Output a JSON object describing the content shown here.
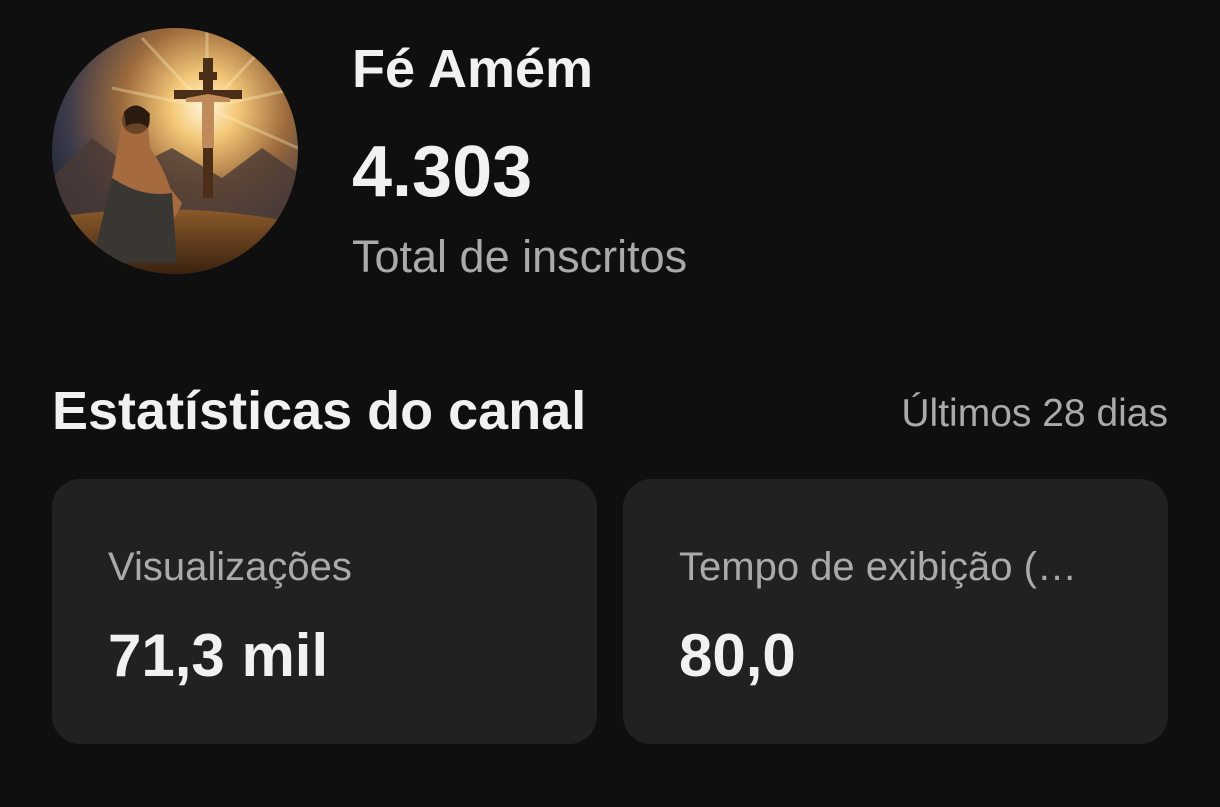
{
  "channel": {
    "name": "Fé Amém",
    "subscriber_count": "4.303",
    "subscriber_label": "Total de inscritos",
    "avatar_icon": "channel-avatar-icon"
  },
  "stats": {
    "title": "Estatísticas do canal",
    "period": "Últimos 28 dias",
    "cards": [
      {
        "label": "Visualizações",
        "value": "71,3 mil"
      },
      {
        "label": "Tempo de exibição (…",
        "value": "80,0"
      }
    ]
  },
  "colors": {
    "background": "#0f0f0f",
    "card": "#212121",
    "primary_text": "#f1f1f1",
    "secondary_text": "#aaaaaa"
  }
}
